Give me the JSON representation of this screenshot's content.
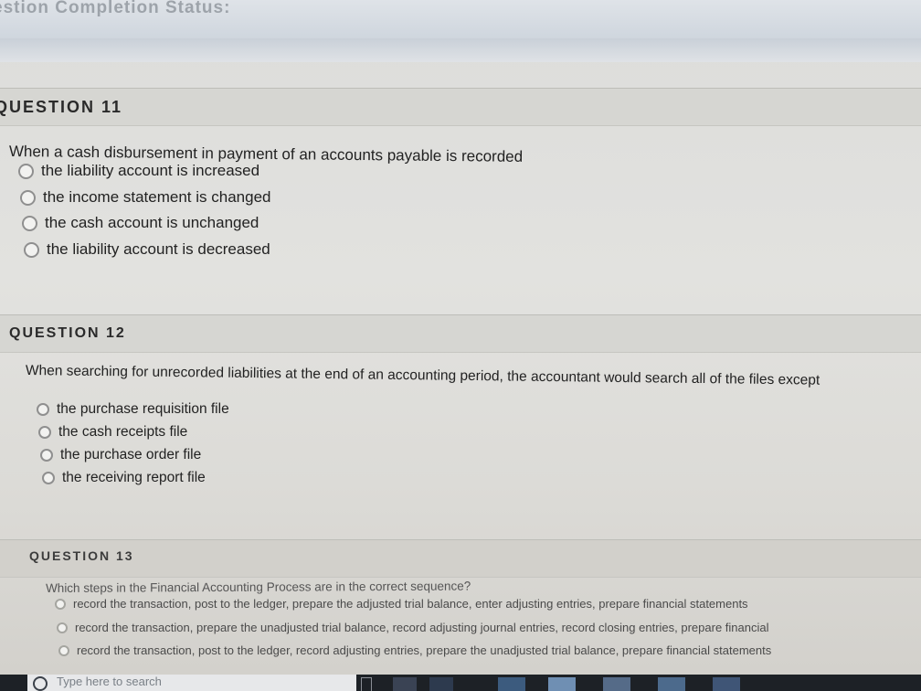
{
  "status": {
    "title": "estion Completion Status:"
  },
  "questions": [
    {
      "title": "QUESTION 11",
      "prompt": "When a cash disbursement in payment of an accounts payable is recorded",
      "options": [
        "the liability account is increased",
        "the income statement is changed",
        "the cash account is unchanged",
        "the liability account is decreased"
      ]
    },
    {
      "title": "QUESTION 12",
      "prompt": "When searching for unrecorded liabilities at the end of an accounting period, the accountant would search all of the files except",
      "options": [
        "the purchase requisition file",
        "the cash receipts file",
        "the purchase order file",
        "the receiving report file"
      ]
    },
    {
      "title": "QUESTION 13",
      "prompt": "Which steps in the Financial Accounting Process are in the correct sequence?",
      "options": [
        "record the transaction, post to the ledger, prepare the adjusted trial balance, enter adjusting entries, prepare financial statements",
        "record the transaction, prepare the unadjusted trial balance, record adjusting journal entries, record closing entries, prepare financial",
        "record the transaction, post to the ledger, record adjusting entries, prepare the unadjusted trial balance, prepare financial statements"
      ]
    }
  ],
  "taskbar": {
    "search_placeholder": "Type here to search",
    "windows_icon": "windows-logo-icon"
  }
}
